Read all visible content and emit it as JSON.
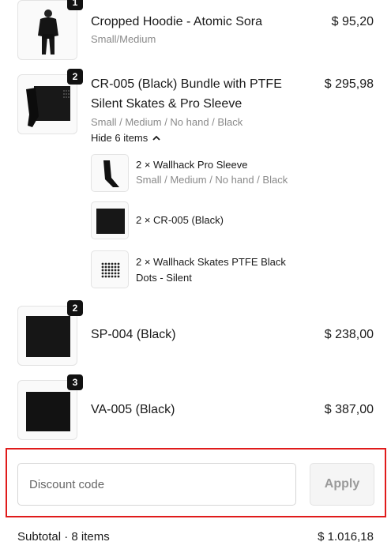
{
  "items": [
    {
      "badge": "1",
      "name": "Cropped Hoodie - Atomic Sora",
      "variant": "Small/Medium",
      "price": "$ 95,20"
    },
    {
      "badge": "2",
      "name": "CR-005 (Black) Bundle with PTFE",
      "name2": "Silent Skates & Pro Sleeve",
      "variant": "Small / Medium / No hand / Black",
      "price": "$ 295,98",
      "toggle_label": "Hide 6 items",
      "sub_items": [
        {
          "name": "2 × Wallhack Pro Sleeve",
          "variant": "Small / Medium / No hand / Black"
        },
        {
          "name": "2 × CR-005 (Black)"
        },
        {
          "name": "2 × Wallhack Skates PTFE Black",
          "name2": "Dots - Silent"
        }
      ]
    },
    {
      "badge": "2",
      "name": "SP-004 (Black)",
      "price": "$ 238,00"
    },
    {
      "badge": "3",
      "name": "VA-005 (Black)",
      "price": "$ 387,00"
    }
  ],
  "discount": {
    "placeholder": "Discount code",
    "apply_label": "Apply"
  },
  "subtotal": {
    "label": "Subtotal · 8 items",
    "value": "$ 1.016,18"
  }
}
